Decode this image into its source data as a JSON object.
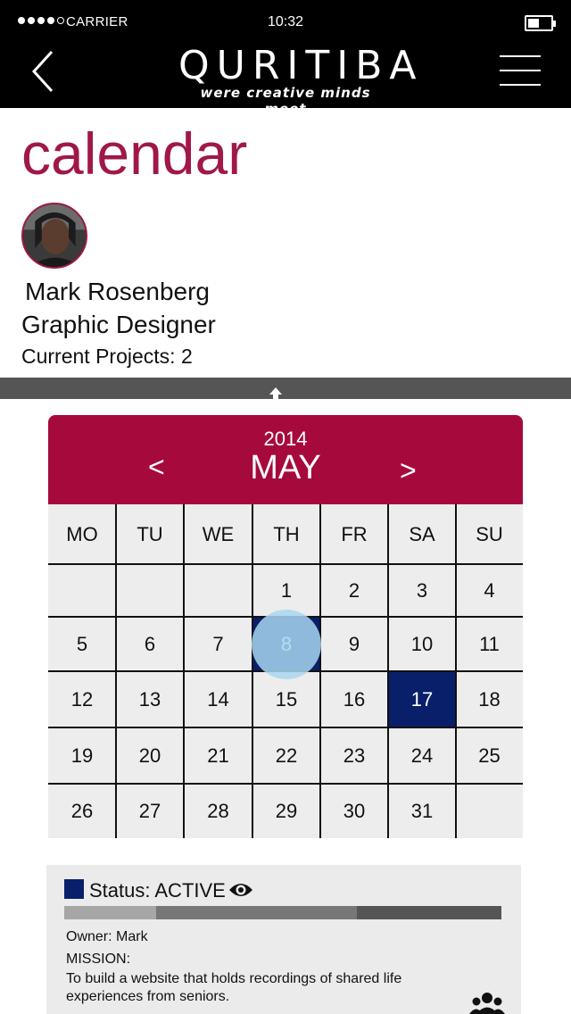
{
  "status_bar": {
    "carrier": "CARRIER",
    "time": "10:32"
  },
  "header": {
    "logo_title": "QURITIBA",
    "logo_tagline": "were creative minds meet"
  },
  "profile": {
    "page_title": "calendar",
    "name": "Mark Rosenberg",
    "role": "Graphic Designer",
    "projects": "Current Projects: 2"
  },
  "calendar": {
    "year": "2014",
    "month": "MAY",
    "prev_label": "<",
    "next_label": ">",
    "weekdays": [
      "MO",
      "TU",
      "WE",
      "TH",
      "FR",
      "SA",
      "SU"
    ],
    "weeks": [
      [
        "",
        "",
        "",
        "1",
        "2",
        "3",
        "4"
      ],
      [
        "5",
        "6",
        "7",
        "8",
        "9",
        "10",
        "11"
      ],
      [
        "12",
        "13",
        "14",
        "15",
        "16",
        "17",
        "18"
      ],
      [
        "19",
        "20",
        "21",
        "22",
        "23",
        "24",
        "25"
      ],
      [
        "26",
        "27",
        "28",
        "29",
        "30",
        "31",
        ""
      ]
    ],
    "highlighted_days": [
      "8",
      "17"
    ],
    "highlight_color": "#0a1f6a",
    "header_color": "#a60a3d"
  },
  "project_card": {
    "status": "Status: ACTIVE",
    "status_color": "#0a1f6a",
    "owner": "Owner: Mark",
    "mission_label": "MISSION:",
    "mission_text": "To build a website that holds recordings of shared life experiences from seniors.",
    "progress_segments": [
      {
        "fraction": 0.21,
        "color": "#a6a6a6"
      },
      {
        "fraction": 0.46,
        "color": "#777777"
      },
      {
        "fraction": 0.33,
        "color": "#555555"
      }
    ]
  },
  "accent_color": "#a0184a"
}
